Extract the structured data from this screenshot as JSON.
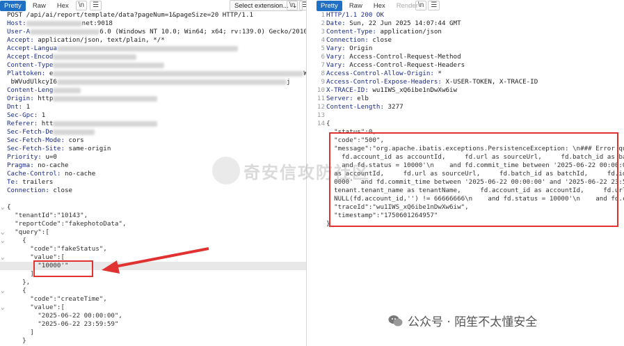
{
  "request_pane": {
    "tabs": [
      {
        "label": "Pretty",
        "active": true
      },
      {
        "label": "Raw"
      },
      {
        "label": "Hex"
      }
    ],
    "newline_toggle": "\\n",
    "menu_icon": "hamburger-icon",
    "select_extension": "Select extension...",
    "lines": [
      {
        "text": "POST /api/ai/report/template/data?pageNum=1&pageSize=20 HTTP/1.1"
      },
      {
        "key": "Host:",
        "val": "",
        "blur": 80,
        "tail": "net:9018"
      },
      {
        "key": "User-A",
        "val": "",
        "blur": 100,
        "tail": "6.0 (Windows NT 10.0; Win64; x64; rv:139.0) Gecko/20100101 Fir"
      },
      {
        "key": "Accept:",
        "val": " application/json, text/plain, */*"
      },
      {
        "key": "Accept-Langua",
        "val": "",
        "blur": 260,
        "tail": ""
      },
      {
        "key": "Accept-Encod",
        "val": "",
        "blur": 120,
        "tail": ""
      },
      {
        "key": "Content-Type",
        "val": "",
        "blur": 160,
        "tail": ""
      },
      {
        "key": "Plattoken:",
        "val": " e",
        "blur": 360,
        "tail": "W"
      },
      {
        "key": "",
        "val": " bWVudUlkcyI6",
        "blur": 330,
        "tail": "j"
      },
      {
        "key": "Content-Leng",
        "val": "",
        "blur": 40,
        "tail": ""
      },
      {
        "key": "Origin:",
        "val": " http",
        "blur": 150,
        "tail": ""
      },
      {
        "key": "Dnt:",
        "val": " 1"
      },
      {
        "key": "Sec-Gpc:",
        "val": " 1"
      },
      {
        "key": "Referer:",
        "val": " htt",
        "blur": 150,
        "tail": ""
      },
      {
        "key": "Sec-Fetch-De",
        "val": "",
        "blur": 60,
        "tail": ""
      },
      {
        "key": "Sec-Fetch-Mode:",
        "val": " cors"
      },
      {
        "key": "Sec-Fetch-Site:",
        "val": " same-origin"
      },
      {
        "key": "Priority:",
        "val": " u=0"
      },
      {
        "key": "Pragma:",
        "val": " no-cache"
      },
      {
        "key": "Cache-Control:",
        "val": " no-cache"
      },
      {
        "key": "Te:",
        "val": " trailers"
      },
      {
        "key": "Connection:",
        "val": " close"
      },
      {
        "text": ""
      },
      {
        "text": "{",
        "fold": true
      },
      {
        "json": "  \"tenantId\":\"10143\","
      },
      {
        "json": "  \"reportCode\":\"fakephotoData\","
      },
      {
        "json": "  \"query\":[",
        "fold": true
      },
      {
        "json": "    {",
        "fold": true
      },
      {
        "json": "      \"code\":\"fakeStatus\","
      },
      {
        "json": "      \"value\":[",
        "fold": true
      },
      {
        "json": "        \"10000'\"",
        "hl": true
      },
      {
        "json": "      ]"
      },
      {
        "json": "    },"
      },
      {
        "json": "    {",
        "fold": true
      },
      {
        "json": "      \"code\":\"createTime\","
      },
      {
        "json": "      \"value\":[",
        "fold": true
      },
      {
        "json": "        \"2025-06-22 00:00:00\","
      },
      {
        "json": "        \"2025-06-22 23:59:59\""
      },
      {
        "json": "      ]"
      },
      {
        "json": "    }"
      }
    ]
  },
  "response_pane": {
    "tabs": [
      {
        "label": "Pretty",
        "active": true
      },
      {
        "label": "Raw"
      },
      {
        "label": "Hex"
      },
      {
        "label": "Render",
        "disabled": true
      }
    ],
    "newline_toggle": "\\n",
    "menu_icon": "hamburger-icon",
    "lines": [
      {
        "n": "1",
        "key": "HTTP/1.1 200 OK",
        "val": ""
      },
      {
        "n": "2",
        "key": "Date:",
        "val": " Sun, 22 Jun 2025 14:07:44 GMT"
      },
      {
        "n": "3",
        "key": "Content-Type:",
        "val": " application/json"
      },
      {
        "n": "4",
        "key": "Connection:",
        "val": " close"
      },
      {
        "n": "5",
        "key": "Vary:",
        "val": " Origin"
      },
      {
        "n": "6",
        "key": "Vary:",
        "val": " Access-Control-Request-Method"
      },
      {
        "n": "7",
        "key": "Vary:",
        "val": " Access-Control-Request-Headers"
      },
      {
        "n": "8",
        "key": "Access-Control-Allow-Origin:",
        "val": " *"
      },
      {
        "n": "9",
        "key": "Access-Control-Expose-Headers:",
        "val": " X-USER-TOKEN, X-TRACE-ID"
      },
      {
        "n": "10",
        "key": "X-TRACE-ID:",
        "val": " wu1IWS_xQ6ibe1nDwXw6iw"
      },
      {
        "n": "11",
        "key": "Server:",
        "val": " elb"
      },
      {
        "n": "12",
        "key": "Content-Length:",
        "val": " 3277"
      },
      {
        "n": "13",
        "key": "",
        "val": ""
      },
      {
        "n": "14",
        "json": "{"
      },
      {
        "n": "",
        "json": "  \"status\":0,"
      },
      {
        "n": "",
        "json": "  \"code\":\"500\","
      },
      {
        "n": "",
        "json": "  \"message\":\"org.apache.ibatis.exceptions.PersistenceException: \\n### Error queryi"
      },
      {
        "n": "",
        "json": "    fd.account_id as accountId,     fd.url as sourceUrl,     fd.batch_id as batchId,"
      },
      {
        "n": "",
        "json": "    and fd.status = 10000'\\n    and fd.commit_time between '2025-06-22 00:00:00'  a"
      },
      {
        "n": "",
        "json": "  as accountId,     fd.url as sourceUrl,     fd.batch_id as batchId,     fd.identi"
      },
      {
        "n": "",
        "json": "  0000'  and fd.commit_time between '2025-06-22 00:00:00' and '2025-06-22 23:59"
      },
      {
        "n": "",
        "json": "  tenant.tenant_name as tenantName,     fd.account_id as accountId,     fd.url as"
      },
      {
        "n": "",
        "json": "  NULL(fd.account_id,'') != 66666666\\n    and fd.status = 10000'\\n    and fd.commi"
      },
      {
        "n": "",
        "json": "  \"traceId\":\"wu1IWS_xQ6ibe1nDwXw6iw\","
      },
      {
        "n": "",
        "json": "  \"timestamp\":\"1750601264957\""
      },
      {
        "n": "",
        "json": "}"
      }
    ]
  },
  "watermark": {
    "text": "奇安信攻防社区"
  },
  "footer": {
    "source": "公众号 · 陌笙不太懂安全"
  },
  "colors": {
    "accent": "#1f6fc5",
    "annotation_red": "#e13232"
  }
}
